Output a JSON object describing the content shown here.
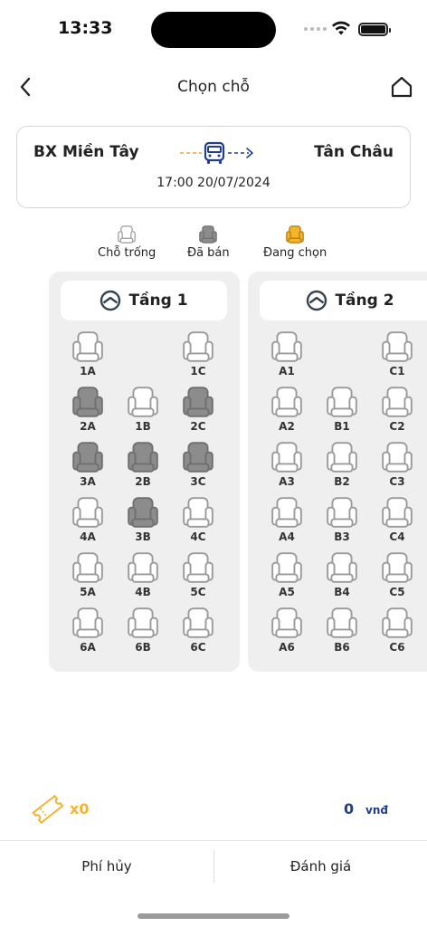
{
  "status_bar": {
    "time": "13:33"
  },
  "header": {
    "title": "Chọn chỗ"
  },
  "route": {
    "from": "BX Miền Tây",
    "to": "Tân Châu",
    "datetime": "17:00 20/07/2024"
  },
  "legend": {
    "available": "Chỗ trống",
    "sold": "Đã bán",
    "selecting": "Đang chọn"
  },
  "colors": {
    "available_fill": "#ffffff",
    "available_stroke": "#9a9a9a",
    "sold_fill": "#8c8c8c",
    "sold_stroke": "#6f6f6f",
    "selecting_fill": "#f4b528",
    "selecting_stroke": "#b07a10",
    "accent_blue": "#1f3e8c",
    "accent_orange": "#f2b431"
  },
  "decks": [
    {
      "title": "Tầng 1",
      "columns": 3,
      "seats": [
        {
          "label": "1A",
          "row": 0,
          "col": 0,
          "status": "available"
        },
        {
          "label": "1C",
          "row": 0,
          "col": 2,
          "status": "available"
        },
        {
          "label": "2A",
          "row": 1,
          "col": 0,
          "status": "sold"
        },
        {
          "label": "1B",
          "row": 1,
          "col": 1,
          "status": "available"
        },
        {
          "label": "2C",
          "row": 1,
          "col": 2,
          "status": "sold"
        },
        {
          "label": "3A",
          "row": 2,
          "col": 0,
          "status": "sold"
        },
        {
          "label": "2B",
          "row": 2,
          "col": 1,
          "status": "sold"
        },
        {
          "label": "3C",
          "row": 2,
          "col": 2,
          "status": "sold"
        },
        {
          "label": "4A",
          "row": 3,
          "col": 0,
          "status": "available"
        },
        {
          "label": "3B",
          "row": 3,
          "col": 1,
          "status": "sold"
        },
        {
          "label": "4C",
          "row": 3,
          "col": 2,
          "status": "available"
        },
        {
          "label": "5A",
          "row": 4,
          "col": 0,
          "status": "available"
        },
        {
          "label": "4B",
          "row": 4,
          "col": 1,
          "status": "available"
        },
        {
          "label": "5C",
          "row": 4,
          "col": 2,
          "status": "available"
        },
        {
          "label": "6A",
          "row": 5,
          "col": 0,
          "status": "available"
        },
        {
          "label": "6B",
          "row": 5,
          "col": 1,
          "status": "available"
        },
        {
          "label": "6C",
          "row": 5,
          "col": 2,
          "status": "available"
        }
      ]
    },
    {
      "title": "Tầng 2",
      "columns": 3,
      "seats": [
        {
          "label": "A1",
          "row": 0,
          "col": 0,
          "status": "available"
        },
        {
          "label": "C1",
          "row": 0,
          "col": 2,
          "status": "available"
        },
        {
          "label": "A2",
          "row": 1,
          "col": 0,
          "status": "available"
        },
        {
          "label": "B1",
          "row": 1,
          "col": 1,
          "status": "available"
        },
        {
          "label": "C2",
          "row": 1,
          "col": 2,
          "status": "available"
        },
        {
          "label": "A3",
          "row": 2,
          "col": 0,
          "status": "available"
        },
        {
          "label": "B2",
          "row": 2,
          "col": 1,
          "status": "available"
        },
        {
          "label": "C3",
          "row": 2,
          "col": 2,
          "status": "available"
        },
        {
          "label": "A4",
          "row": 3,
          "col": 0,
          "status": "available"
        },
        {
          "label": "B3",
          "row": 3,
          "col": 1,
          "status": "available"
        },
        {
          "label": "C4",
          "row": 3,
          "col": 2,
          "status": "available"
        },
        {
          "label": "A5",
          "row": 4,
          "col": 0,
          "status": "available"
        },
        {
          "label": "B4",
          "row": 4,
          "col": 1,
          "status": "available"
        },
        {
          "label": "C5",
          "row": 4,
          "col": 2,
          "status": "available"
        },
        {
          "label": "A6",
          "row": 5,
          "col": 0,
          "status": "available"
        },
        {
          "label": "B6",
          "row": 5,
          "col": 1,
          "status": "available"
        },
        {
          "label": "C6",
          "row": 5,
          "col": 2,
          "status": "available"
        }
      ]
    }
  ],
  "summary": {
    "ticket_count": "x0",
    "total_amount": "0",
    "currency": "vnđ"
  },
  "footer": {
    "cancel_fee_label": "Phí hủy",
    "review_label": "Đánh giá"
  }
}
